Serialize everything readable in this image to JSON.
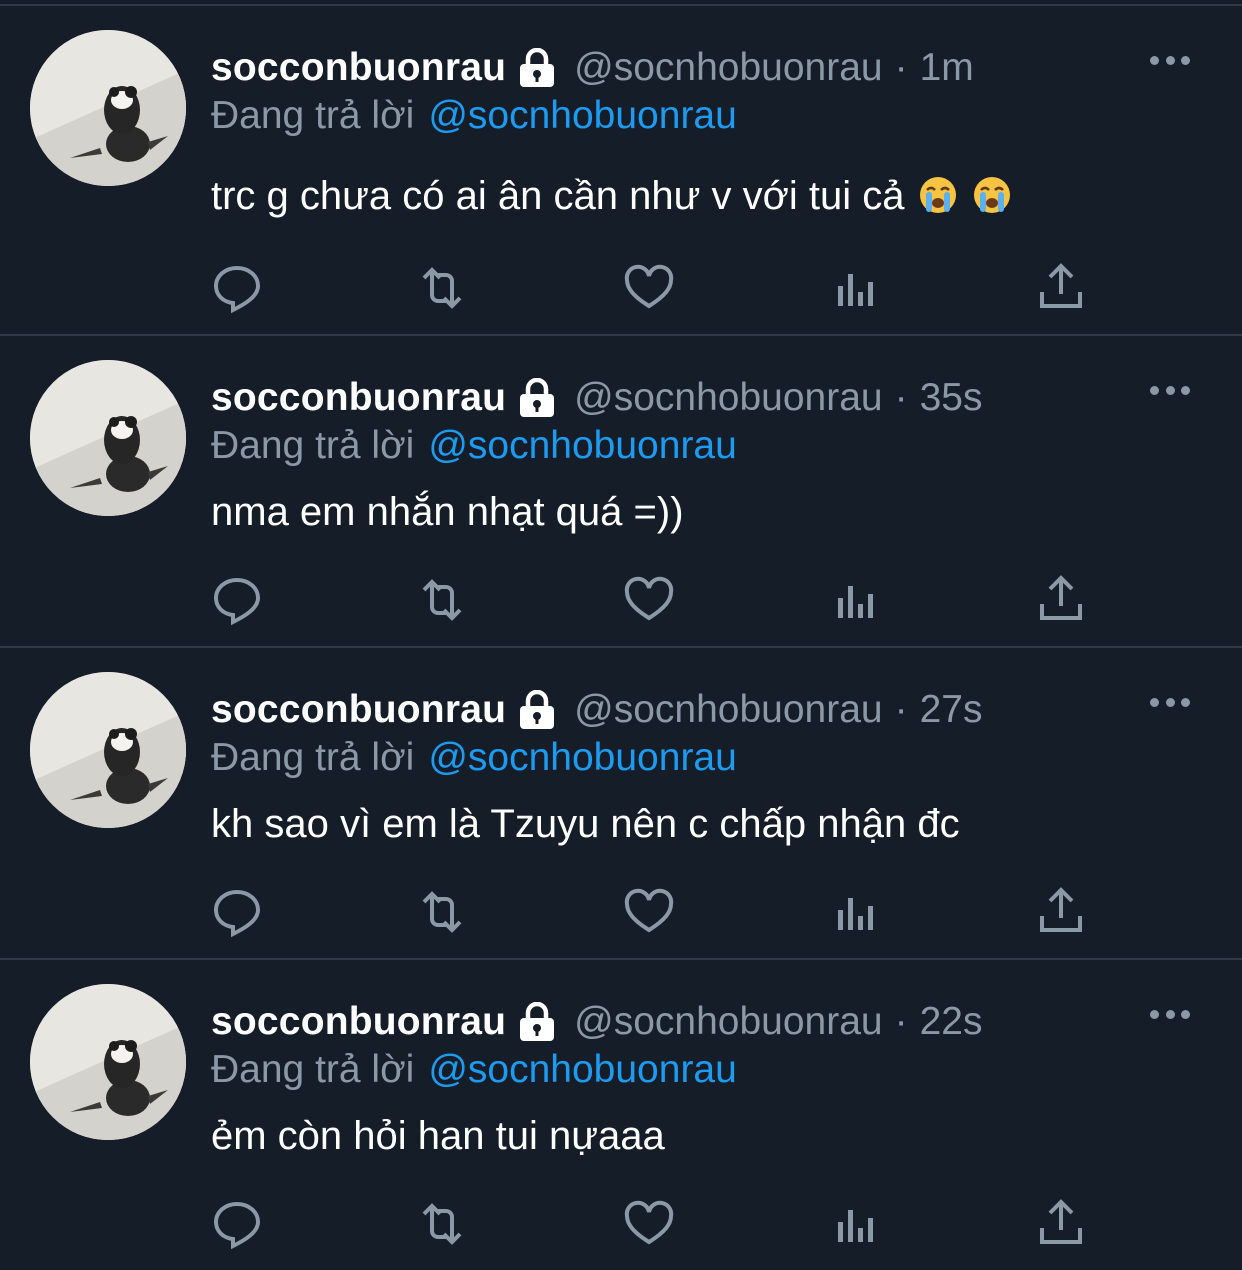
{
  "tweets": [
    {
      "display_name": "socconbuonrau",
      "handle": "@socnhobuonrau",
      "separator": "·",
      "time": "1m",
      "reply_prefix": "Đang trả lời",
      "reply_to": "@socnhobuonrau",
      "text": "trc g chưa có ai ân cần như v với tui cả",
      "emojis": [
        "loudly-crying-face",
        "loudly-crying-face"
      ]
    },
    {
      "display_name": "socconbuonrau",
      "handle": "@socnhobuonrau",
      "separator": "·",
      "time": "35s",
      "reply_prefix": "Đang trả lời",
      "reply_to": "@socnhobuonrau",
      "text": "nma em nhắn nhạt quá =))",
      "emojis": []
    },
    {
      "display_name": "socconbuonrau",
      "handle": "@socnhobuonrau",
      "separator": "·",
      "time": "27s",
      "reply_prefix": "Đang trả lời",
      "reply_to": "@socnhobuonrau",
      "text": "kh sao vì em là Tzuyu nên c chấp nhận đc",
      "emojis": []
    },
    {
      "display_name": "socconbuonrau",
      "handle": "@socnhobuonrau",
      "separator": "·",
      "time": "22s",
      "reply_prefix": "Đang trả lời",
      "reply_to": "@socnhobuonrau",
      "text": "ẻm còn hỏi han tui nựaaa",
      "emojis": []
    }
  ],
  "icons": {
    "verified_lock": "lock-icon",
    "more": "more-icon",
    "actions": [
      "reply-icon",
      "retweet-icon",
      "like-icon",
      "stats-icon",
      "share-icon"
    ]
  },
  "colors": {
    "background": "#151d28",
    "divider": "#2f3a47",
    "secondary_text": "#8b98a5",
    "link": "#1d9bf0",
    "primary_text": "#ffffff"
  }
}
